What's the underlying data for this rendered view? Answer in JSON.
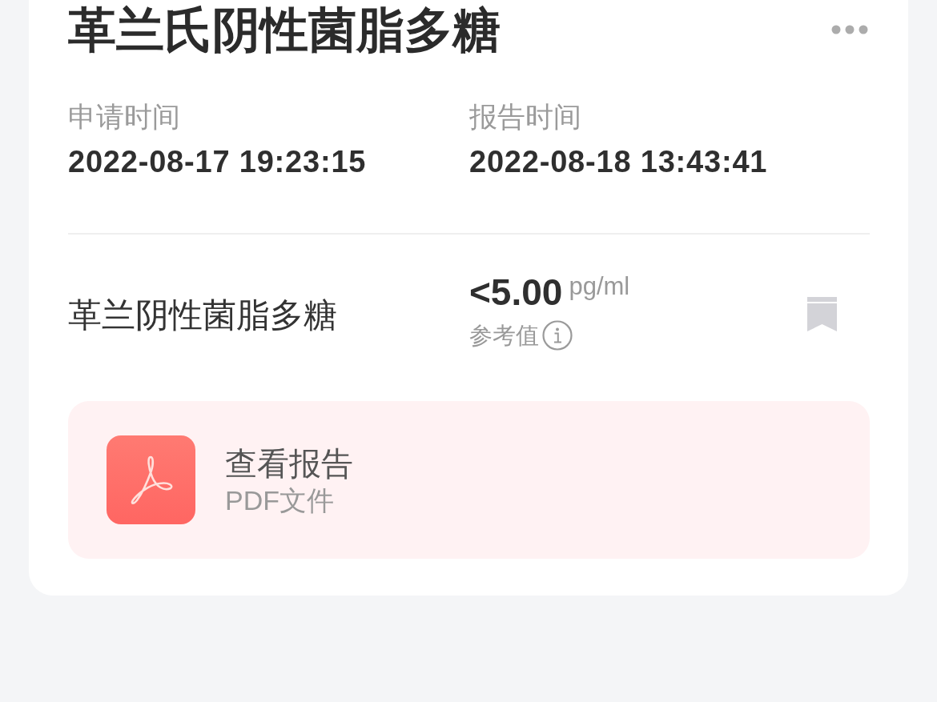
{
  "title": "革兰氏阴性菌脂多糖",
  "times": [
    {
      "label": "申请时间",
      "value": "2022-08-17 19:23:15"
    },
    {
      "label": "报告时间",
      "value": "2022-08-18 13:43:41"
    }
  ],
  "result": {
    "name": "革兰阴性菌脂多糖",
    "value": "<5.00",
    "unit": "pg/ml",
    "reference_label": "参考值"
  },
  "report": {
    "title": "查看报告",
    "subtitle": "PDF文件"
  }
}
